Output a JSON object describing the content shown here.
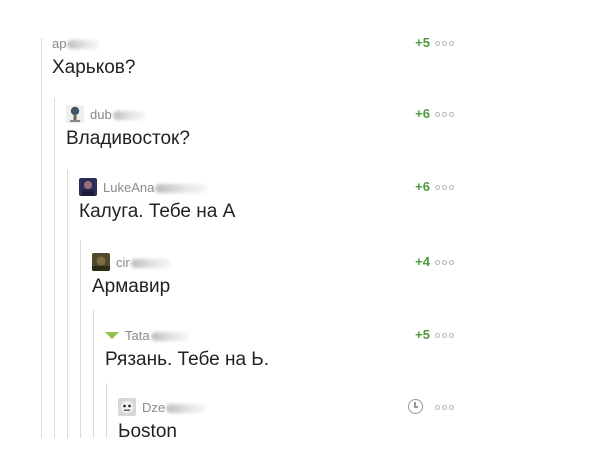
{
  "comments": [
    {
      "user": "ap",
      "rating": "+5",
      "text": "Харьков?"
    },
    {
      "user": "dub",
      "rating": "+6",
      "text": "Владивосток?"
    },
    {
      "user": "LukeAna",
      "rating": "+6",
      "text": "Калуга. Тебе на А"
    },
    {
      "user": "cir",
      "rating": "+4",
      "text": "Армавир"
    },
    {
      "user": "Tata",
      "rating": "+5",
      "text": "Рязань. Тебе на Ь."
    },
    {
      "user": "Dze",
      "rating": "",
      "text": "Ьoston"
    }
  ],
  "icons": {
    "more": "three-dots-icon",
    "pending": "clock-icon",
    "gender": "triangle-icon"
  },
  "colors": {
    "rating": "#4f9a3c",
    "text": "#222222",
    "username": "#8a8a8a",
    "rail": "#dcdcdc",
    "accent_triangle": "#8bc34a"
  }
}
